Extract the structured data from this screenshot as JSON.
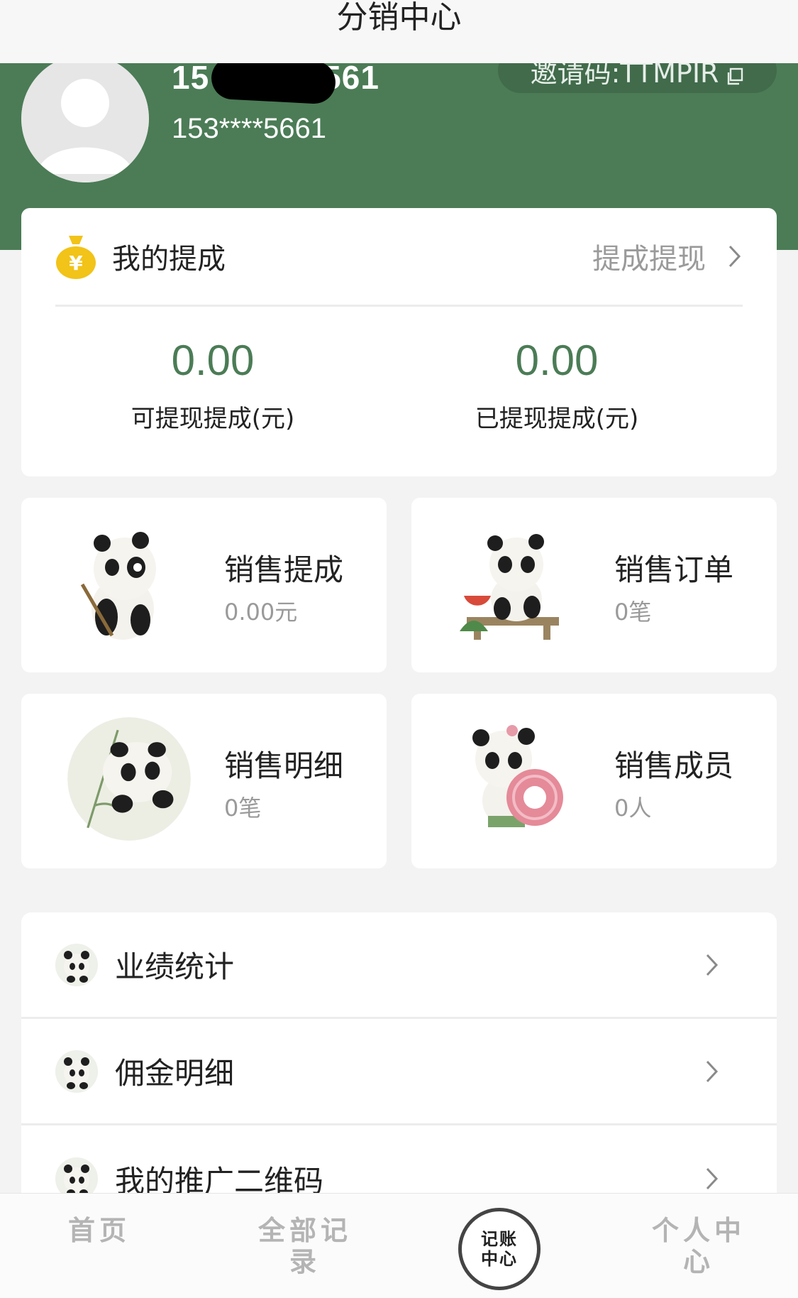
{
  "nav": {
    "title": "分销中心"
  },
  "profile": {
    "name_visible_start": "15",
    "name_visible_end": "561",
    "phone": "153****5661",
    "invite_text": "邀请码:TTMPIR"
  },
  "commission": {
    "label": "我的提成",
    "withdraw_link": "提成提现",
    "available": {
      "value": "0.00",
      "caption": "可提现提成(元)"
    },
    "withdrawn": {
      "value": "0.00",
      "caption": "已提现提成(元)"
    }
  },
  "tiles": [
    {
      "title": "销售提成",
      "sub": "0.00元"
    },
    {
      "title": "销售订单",
      "sub": "0笔"
    },
    {
      "title": "销售明细",
      "sub": "0笔"
    },
    {
      "title": "销售成员",
      "sub": "0人"
    }
  ],
  "menu": [
    {
      "label": "业绩统计"
    },
    {
      "label": "佣金明细"
    },
    {
      "label": "我的推广二维码"
    }
  ],
  "tabbar": {
    "home": "首页",
    "records": "全部记录",
    "center_line1": "记账",
    "center_line2": "中心",
    "profile": "个人中心"
  },
  "colors": {
    "brand_green": "#4b7c56",
    "muted": "#9a9a9a"
  },
  "icons": [
    "user-avatar-icon",
    "copy-icon",
    "money-bag-icon",
    "chevron-right-icon",
    "panda-icon"
  ]
}
